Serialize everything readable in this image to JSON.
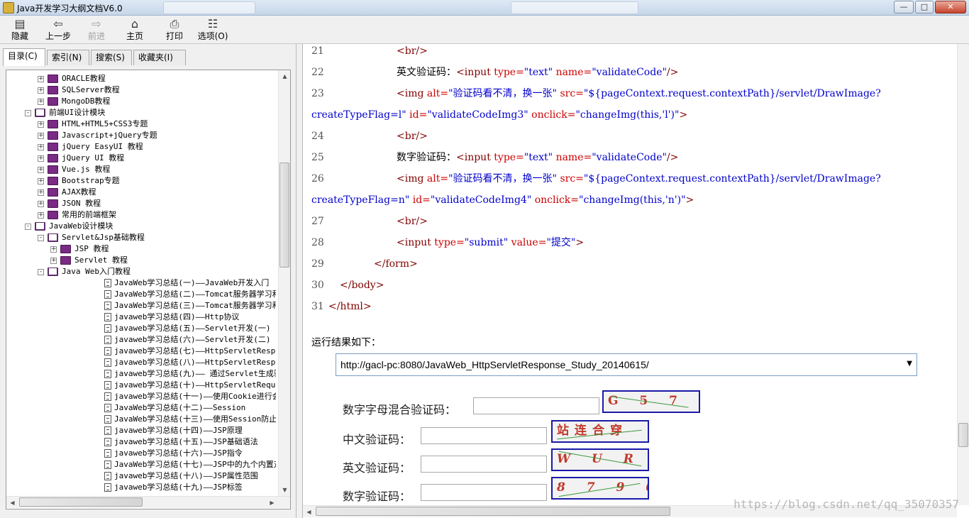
{
  "window": {
    "title": "Java开发学习大纲文档V6.0",
    "controls": {
      "minimize": "—",
      "maximize": "□",
      "close": "✕"
    }
  },
  "toolbar": {
    "buttons": [
      {
        "label": "隐藏",
        "icon": "hide-icon"
      },
      {
        "label": "上一步",
        "icon": "back-arrow-icon"
      },
      {
        "label": "前进",
        "icon": "forward-arrow-icon",
        "disabled": true
      },
      {
        "label": "主页",
        "icon": "home-icon"
      },
      {
        "label": "打印",
        "icon": "print-icon"
      },
      {
        "label": "选项(O)",
        "icon": "options-icon"
      }
    ]
  },
  "nav_tabs": [
    "目录(C)",
    "索引(N)",
    "搜索(S)",
    "收藏夹(I)"
  ],
  "tree": [
    {
      "text": "ORACLE教程",
      "expander": "+",
      "icon": "book"
    },
    {
      "text": "SQLServer教程",
      "expander": "+",
      "icon": "book"
    },
    {
      "text": "MongoDB教程",
      "expander": "+",
      "icon": "book"
    },
    {
      "text": "前端UI设计模块",
      "expander": "−",
      "icon": "book-open"
    },
    {
      "text": "HTML+HTML5+CSS3专题",
      "expander": "+",
      "icon": "book"
    },
    {
      "text": "Javascript+jQuery专题",
      "expander": "+",
      "icon": "book"
    },
    {
      "text": "jQuery EasyUI 教程",
      "expander": "+",
      "icon": "book"
    },
    {
      "text": "jQuery UI 教程",
      "expander": "+",
      "icon": "book"
    },
    {
      "text": "Vue.js 教程",
      "expander": "+",
      "icon": "book"
    },
    {
      "text": "Bootstrap专题",
      "expander": "+",
      "icon": "book"
    },
    {
      "text": "AJAX教程",
      "expander": "+",
      "icon": "book"
    },
    {
      "text": "JSON 教程",
      "expander": "+",
      "icon": "book"
    },
    {
      "text": "常用的前端框架",
      "expander": "+",
      "icon": "book"
    },
    {
      "text": "JavaWeb设计模块",
      "expander": "−",
      "icon": "book-open"
    },
    {
      "text": "Servlet&Jsp基础教程",
      "expander": "−",
      "icon": "book-open"
    },
    {
      "text": "JSP 教程",
      "expander": "+",
      "icon": "book"
    },
    {
      "text": "Servlet 教程",
      "expander": "+",
      "icon": "book"
    },
    {
      "text": "Java Web入门教程",
      "expander": "−",
      "icon": "book-open"
    },
    {
      "text": "JavaWeb学习总结(一)——JavaWeb开发入门",
      "icon": "page"
    },
    {
      "text": "JavaWeb学习总结(二)——Tomcat服务器学习和使用(一",
      "icon": "page"
    },
    {
      "text": "JavaWeb学习总结(三)——Tomcat服务器学习和使用(二",
      "icon": "page"
    },
    {
      "text": "javaweb学习总结(四)——Http协议",
      "icon": "page"
    },
    {
      "text": "javaweb学习总结(五)——Servlet开发(一)",
      "icon": "page"
    },
    {
      "text": "javaweb学习总结(六)——Servlet开发(二)",
      "icon": "page"
    },
    {
      "text": "javaweb学习总结(七)——HttpServletResponse对象(",
      "icon": "page"
    },
    {
      "text": "javaweb学习总结(八)——HttpServletResponse对象(",
      "icon": "page"
    },
    {
      "text": "javaweb学习总结(九)—— 通过Servlet生成验证码图",
      "icon": "page"
    },
    {
      "text": "javaweb学习总结(十)——HttpServletRequest对象(一",
      "icon": "page"
    },
    {
      "text": "javaweb学习总结(十一)——使用Cookie进行会话管理",
      "icon": "page"
    },
    {
      "text": "JavaWeb学习总结(十二)——Session",
      "icon": "page"
    },
    {
      "text": "JavaWeb学习总结(十三)——使用Session防止表单重复",
      "icon": "page"
    },
    {
      "text": "javaweb学习总结(十四)——JSP原理",
      "icon": "page"
    },
    {
      "text": "javaweb学习总结(十五)——JSP基础语法",
      "icon": "page"
    },
    {
      "text": "javaweb学习总结(十六)——JSP指令",
      "icon": "page"
    },
    {
      "text": "JavaWeb学习总结(十七)——JSP中的九个内置对象",
      "icon": "page"
    },
    {
      "text": "javaweb学习总结(十八)——JSP属性范围",
      "icon": "page"
    },
    {
      "text": "javaweb学习总结(十九)——JSP标签",
      "icon": "page"
    }
  ],
  "code_lines": [
    {
      "num": "21",
      "tokens": [
        {
          "t": "<br/>",
          "c": "tag"
        }
      ]
    },
    {
      "num": "22",
      "tokens": [
        {
          "t": "英文验证码：",
          "c": "plain"
        },
        {
          "t": "<input ",
          "c": "tag"
        },
        {
          "t": "type=",
          "c": "attr"
        },
        {
          "t": "\"text\" ",
          "c": "val"
        },
        {
          "t": "name=",
          "c": "attr"
        },
        {
          "t": "\"validateCode\"",
          "c": "val"
        },
        {
          "t": "/>",
          "c": "tag"
        }
      ]
    },
    {
      "num": "23",
      "tokens": [
        {
          "t": "<img ",
          "c": "tag"
        },
        {
          "t": "alt=",
          "c": "attr"
        },
        {
          "t": "\"验证码看不清，换一张\" ",
          "c": "val"
        },
        {
          "t": "src=",
          "c": "attr"
        },
        {
          "t": "\"${pageContext.request.contextPath}/servlet/DrawImage?",
          "c": "val"
        }
      ]
    },
    {
      "num": "",
      "tokens": [
        {
          "t": "createTypeFlag=l\" ",
          "c": "val"
        },
        {
          "t": "id=",
          "c": "attr"
        },
        {
          "t": "\"validateCodeImg3\" ",
          "c": "val"
        },
        {
          "t": "onclick=",
          "c": "attr"
        },
        {
          "t": "\"changeImg(this,'l')\"",
          "c": "val"
        },
        {
          "t": ">",
          "c": "tag"
        }
      ]
    },
    {
      "num": "24",
      "tokens": [
        {
          "t": "<br/>",
          "c": "tag"
        }
      ]
    },
    {
      "num": "25",
      "tokens": [
        {
          "t": "数字验证码：",
          "c": "plain"
        },
        {
          "t": "<input ",
          "c": "tag"
        },
        {
          "t": "type=",
          "c": "attr"
        },
        {
          "t": "\"text\" ",
          "c": "val"
        },
        {
          "t": "name=",
          "c": "attr"
        },
        {
          "t": "\"validateCode\"",
          "c": "val"
        },
        {
          "t": "/>",
          "c": "tag"
        }
      ]
    },
    {
      "num": "26",
      "tokens": [
        {
          "t": "<img ",
          "c": "tag"
        },
        {
          "t": "alt=",
          "c": "attr"
        },
        {
          "t": "\"验证码看不清，换一张\" ",
          "c": "val"
        },
        {
          "t": "src=",
          "c": "attr"
        },
        {
          "t": "\"${pageContext.request.contextPath}/servlet/DrawImage?",
          "c": "val"
        }
      ]
    },
    {
      "num": "",
      "tokens": [
        {
          "t": "createTypeFlag=n\" ",
          "c": "val"
        },
        {
          "t": "id=",
          "c": "attr"
        },
        {
          "t": "\"validateCodeImg4\" ",
          "c": "val"
        },
        {
          "t": "onclick=",
          "c": "attr"
        },
        {
          "t": "\"changeImg(this,'n')\"",
          "c": "val"
        },
        {
          "t": ">",
          "c": "tag"
        }
      ]
    },
    {
      "num": "27",
      "tokens": [
        {
          "t": "<br/>",
          "c": "tag"
        }
      ]
    },
    {
      "num": "28",
      "tokens": [
        {
          "t": "<input ",
          "c": "tag"
        },
        {
          "t": "type=",
          "c": "attr"
        },
        {
          "t": "\"submit\" ",
          "c": "val"
        },
        {
          "t": "value=",
          "c": "attr"
        },
        {
          "t": "\"提交\"",
          "c": "val"
        },
        {
          "t": ">",
          "c": "tag"
        }
      ]
    },
    {
      "num": "29",
      "tokens": [
        {
          "t": "</form>",
          "c": "tag"
        }
      ]
    },
    {
      "num": "30",
      "tokens": [
        {
          "t": "</body>",
          "c": "tag"
        }
      ]
    },
    {
      "num": "31",
      "tokens": [
        {
          "t": "</html>",
          "c": "tag"
        }
      ]
    }
  ],
  "result": {
    "label": "运行结果如下：",
    "url": "http://gacl-pc:8080/JavaWeb_HttpServletResponse_Study_20140615/",
    "rows": [
      {
        "label": "数字字母混合验证码：",
        "captcha": "G 5 7 3",
        "captcha_color": "#c0392b"
      },
      {
        "label": "中文验证码：",
        "captcha": "站连合穿",
        "captcha_color": "#c0392b"
      },
      {
        "label": "英文验证码：",
        "captcha": "W U R N",
        "captcha_color": "#c0392b"
      },
      {
        "label": "数字验证码：",
        "captcha": "8 7 9 6",
        "captcha_color": "#c0392b"
      }
    ]
  },
  "watermark": "https://blog.csdn.net/qq_35070357",
  "colors": {
    "tag": "#800000",
    "attr": "#cc0000",
    "val": "#0000cc",
    "captcha_border": "#1a1aa8"
  }
}
